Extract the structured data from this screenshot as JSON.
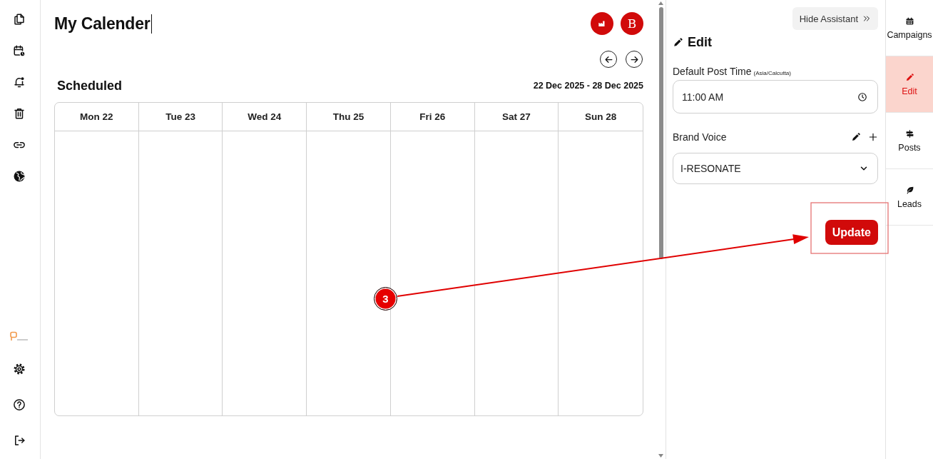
{
  "page": {
    "title": "My Calender",
    "editing": true
  },
  "header": {
    "account_initial": "B"
  },
  "calendar": {
    "heading": "Scheduled",
    "range": "22 Dec 2025 - 28 Dec 2025",
    "days": [
      "Mon 22",
      "Tue 23",
      "Wed 24",
      "Thu 25",
      "Fri 26",
      "Sat 27",
      "Sun 28"
    ]
  },
  "assistant": {
    "hide_button": "Hide Assistant",
    "heading": "Edit",
    "post_time": {
      "label": "Default Post Time",
      "zone": "(Asia/Calcutta)",
      "value": "11:00 AM"
    },
    "brand_voice": {
      "label": "Brand Voice",
      "value": "I-RESONATE"
    },
    "submit_button": "Update"
  },
  "side_tabs": [
    {
      "label": "Campaigns",
      "selected": false
    },
    {
      "label": "Edit",
      "selected": true
    },
    {
      "label": "Posts",
      "selected": false
    },
    {
      "label": "Leads",
      "selected": false
    }
  ],
  "annotation": {
    "step": "3"
  }
}
